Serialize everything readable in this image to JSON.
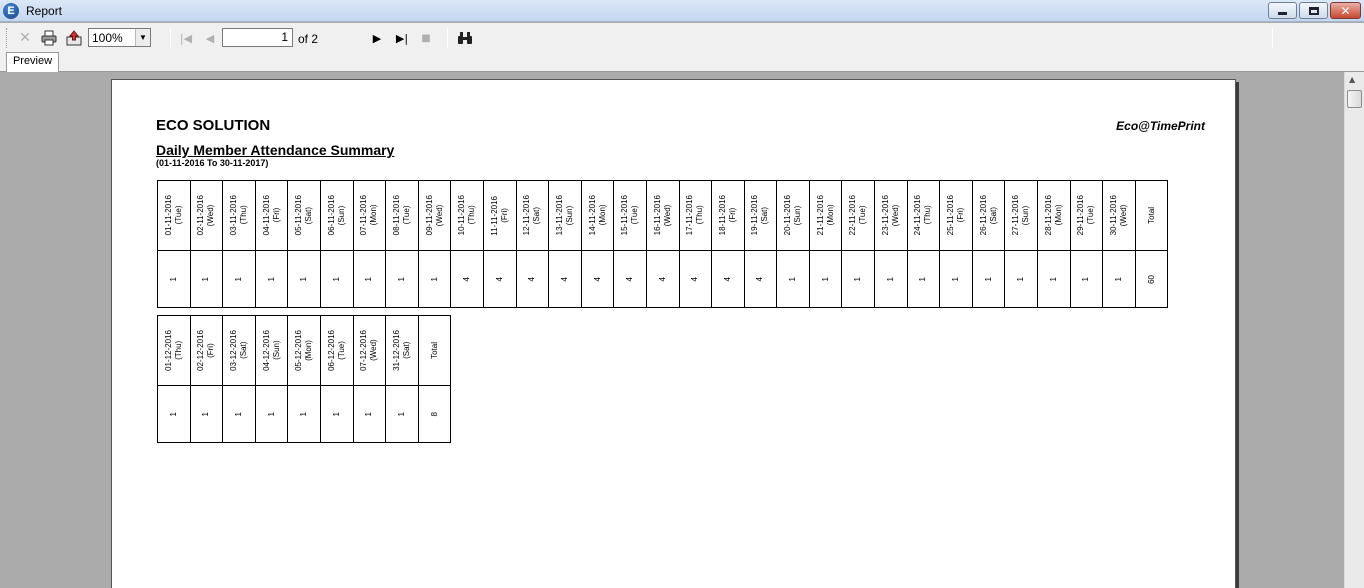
{
  "window": {
    "title": "Report",
    "app_icon_letter": "E"
  },
  "toolbar": {
    "zoom": "100%",
    "current_page": "1",
    "page_of": "of 2"
  },
  "tabs": [
    {
      "label": "Preview"
    }
  ],
  "report": {
    "company": "ECO SOLUTION",
    "brand": "Eco@TimePrint",
    "title": "Daily Member Attendance Summary",
    "range": "(01-11-2016 To 30-11-2017)",
    "table1": {
      "headers": [
        "01-11-2016\n(Tue)",
        "02-11-2016\n(Wed)",
        "03-11-2016\n(Thu)",
        "04-11-2016\n(Fri)",
        "05-11-2016\n(Sat)",
        "06-11-2016\n(Sun)",
        "07-11-2016\n(Mon)",
        "08-11-2016\n(Tue)",
        "09-11-2016\n(Wed)",
        "10-11-2016\n(Thu)",
        "11-11-2016\n(Fri)",
        "12-11-2016\n(Sat)",
        "13-11-2016\n(Sun)",
        "14-11-2016\n(Mon)",
        "15-11-2016\n(Tue)",
        "16-11-2016\n(Wed)",
        "17-11-2016\n(Thu)",
        "18-11-2016\n(Fri)",
        "19-11-2016\n(Sat)",
        "20-11-2016\n(Sun)",
        "21-11-2016\n(Mon)",
        "22-11-2016\n(Tue)",
        "23-11-2016\n(Wed)",
        "24-11-2016\n(Thu)",
        "25-11-2016\n(Fri)",
        "26-11-2016\n(Sat)",
        "27-11-2016\n(Sun)",
        "28-11-2016\n(Mon)",
        "29-11-2016\n(Tue)",
        "30-11-2016\n(Wed)",
        "Total"
      ],
      "values": [
        "1",
        "1",
        "1",
        "1",
        "1",
        "1",
        "1",
        "1",
        "1",
        "4",
        "4",
        "4",
        "4",
        "4",
        "4",
        "4",
        "4",
        "4",
        "4",
        "1",
        "1",
        "1",
        "1",
        "1",
        "1",
        "1",
        "1",
        "1",
        "1",
        "1",
        "60"
      ]
    },
    "table2": {
      "headers": [
        "01-12-2016\n(Thu)",
        "02-12-2016\n(Fri)",
        "03-12-2016\n(Sat)",
        "04-12-2016\n(Sun)",
        "05-12-2016\n(Mon)",
        "06-12-2016\n(Tue)",
        "07-12-2016\n(Wed)",
        "31-12-2016\n(Sat)",
        "Total"
      ],
      "values": [
        "1",
        "1",
        "1",
        "1",
        "1",
        "1",
        "1",
        "1",
        "8"
      ]
    }
  }
}
